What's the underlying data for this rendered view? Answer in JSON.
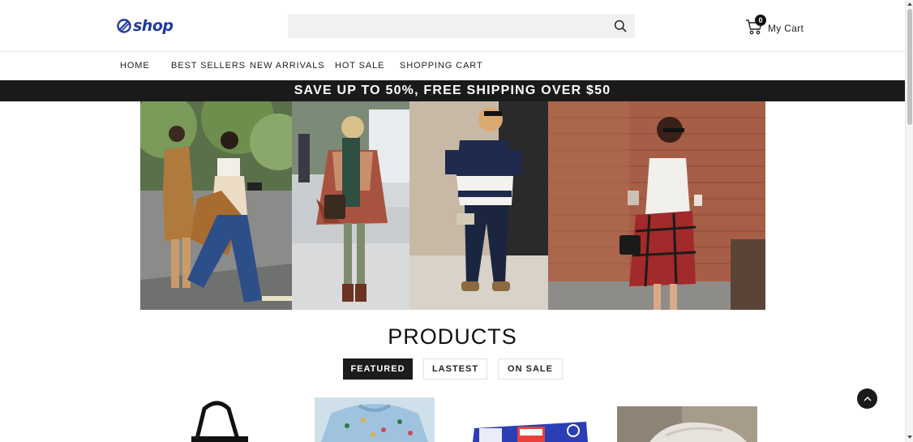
{
  "header": {
    "logo_text": "shop",
    "search": {
      "value": "",
      "placeholder": ""
    },
    "cart": {
      "count": "0",
      "label": "My Cart"
    }
  },
  "nav": {
    "items": [
      {
        "label": "HOME"
      },
      {
        "label": "BEST SELLERS"
      },
      {
        "label": "NEW ARRIVALS"
      },
      {
        "label": "HOT SALE"
      },
      {
        "label": "SHOPPING CART"
      }
    ]
  },
  "promo": {
    "text": "SAVE UP TO 50%, FREE SHIPPING OVER $50"
  },
  "products": {
    "title": "PRODUCTS",
    "tabs": [
      {
        "label": "FEATURED",
        "active": true
      },
      {
        "label": "LASTEST",
        "active": false
      },
      {
        "label": "ON SALE",
        "active": false
      }
    ]
  },
  "colors": {
    "brand": "#1f3a9e",
    "dark": "#1a1a1a",
    "search_bg": "#f1f1f1"
  },
  "icons": {
    "search": "search-icon",
    "cart": "cart-icon",
    "back_to_top": "chevron-up-icon"
  }
}
